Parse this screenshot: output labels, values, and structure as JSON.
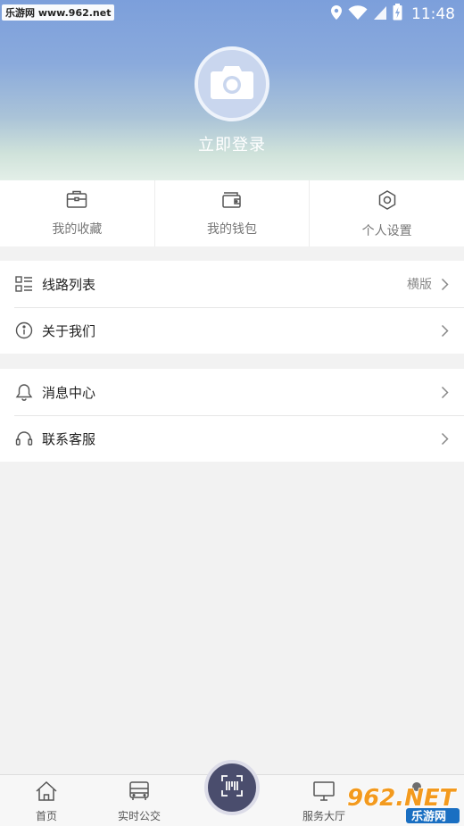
{
  "status_bar": {
    "watermark": "乐游网 www.962.net",
    "time": "11:48"
  },
  "profile": {
    "login_label": "立即登录"
  },
  "quick_actions": [
    {
      "label": "我的收藏",
      "icon": "briefcase-icon"
    },
    {
      "label": "我的钱包",
      "icon": "wallet-icon"
    },
    {
      "label": "个人设置",
      "icon": "settings-icon"
    }
  ],
  "menu_group_1": [
    {
      "label": "线路列表",
      "extra": "横版",
      "icon": "list-icon"
    },
    {
      "label": "关于我们",
      "extra": "",
      "icon": "info-icon"
    }
  ],
  "menu_group_2": [
    {
      "label": "消息中心",
      "icon": "bell-icon"
    },
    {
      "label": "联系客服",
      "icon": "headset-icon"
    }
  ],
  "bottom_nav": [
    {
      "label": "首页",
      "icon": "home-icon"
    },
    {
      "label": "实时公交",
      "icon": "bus-icon"
    },
    {
      "label": "扫码",
      "icon": "scan-icon"
    },
    {
      "label": "服务大厅",
      "icon": "monitor-icon"
    }
  ],
  "watermark_bottom": {
    "brand": "962.NET",
    "subtitle": "乐游网"
  },
  "colors": {
    "header_top": "#7c9fdb",
    "header_bottom": "#e3efe8",
    "scan_button": "#4a4d6d",
    "icon_stroke": "#555555"
  }
}
